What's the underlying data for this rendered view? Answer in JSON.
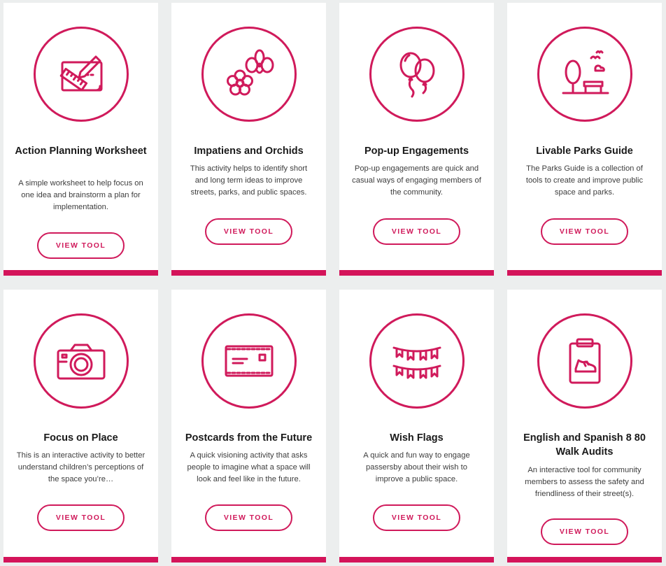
{
  "colors": {
    "accent": "#d4145a",
    "background": "#eceeee",
    "card": "#ffffff"
  },
  "cards": [
    {
      "title": "Action Planning Worksheet",
      "description": "A simple worksheet to help focus on one idea and brainstorm a plan for implementation.",
      "button": "VIEW TOOL",
      "icon": "planning-worksheet-icon"
    },
    {
      "title": "Impatiens and Orchids",
      "description": "This activity helps to identify short and long term ideas to improve streets, parks, and public spaces.",
      "button": "VIEW TOOL",
      "icon": "flowers-icon"
    },
    {
      "title": "Pop-up Engagements",
      "description": "Pop-up engagements are quick and casual ways of engaging members of the community.",
      "button": "VIEW TOOL",
      "icon": "balloons-icon"
    },
    {
      "title": "Livable Parks Guide",
      "description": "The Parks Guide is a collection of tools to create and improve public space and parks.",
      "button": "VIEW TOOL",
      "icon": "park-icon"
    },
    {
      "title": "Focus on Place",
      "description": "This is an interactive activity to better understand children’s perceptions of the space you’re…",
      "button": "VIEW TOOL",
      "icon": "camera-icon"
    },
    {
      "title": "Postcards from the Future",
      "description": "A quick visioning activity that asks people to imagine what a space will look and feel like in the future.",
      "button": "VIEW TOOL",
      "icon": "postcard-icon"
    },
    {
      "title": "Wish Flags",
      "description": "A quick and fun way to engage passersby about their wish to improve a public space.",
      "button": "VIEW TOOL",
      "icon": "bunting-flags-icon"
    },
    {
      "title": "English and Spanish 8 80 Walk Audits",
      "description": "An interactive tool for community members to assess the safety and friendliness of their street(s).",
      "button": "VIEW TOOL",
      "icon": "clipboard-shoe-icon"
    }
  ]
}
